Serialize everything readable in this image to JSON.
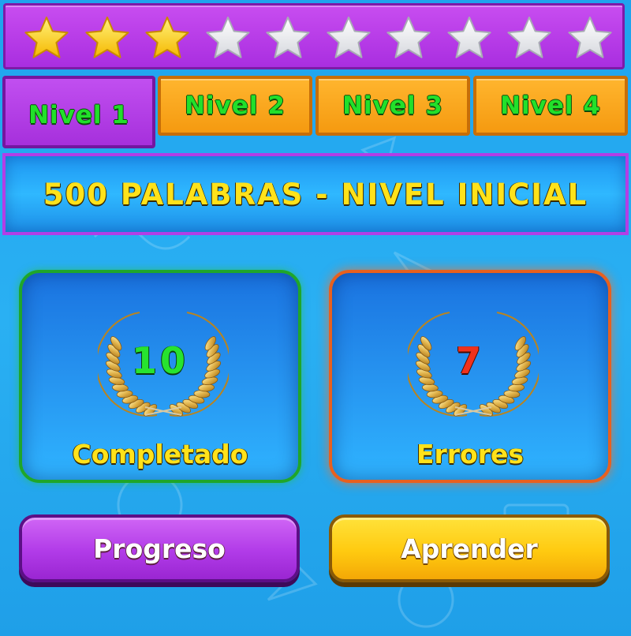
{
  "rating": {
    "filled_stars": 3,
    "total_stars": 10
  },
  "tabs": [
    {
      "label": "Nivel 1",
      "active": true
    },
    {
      "label": "Nivel 2",
      "active": false
    },
    {
      "label": "Nivel 3",
      "active": false
    },
    {
      "label": "Nivel 4",
      "active": false
    }
  ],
  "banner": {
    "title": "500 PALABRAS - NIVEL INICIAL"
  },
  "stats": {
    "completed": {
      "value": "10",
      "label": "Completado",
      "icon": "laurel-wreath-icon"
    },
    "errors": {
      "value": "7",
      "label": "Errores",
      "icon": "laurel-wreath-icon"
    }
  },
  "buttons": {
    "progress_label": "Progreso",
    "learn_label": "Aprender"
  },
  "colors": {
    "purple": "#b13be8",
    "orange_tab": "#f59a10",
    "text_green": "#27e32f",
    "text_yellow": "#ffe21a",
    "error_red": "#f0321c",
    "background_blue": "#2ab0f3"
  }
}
